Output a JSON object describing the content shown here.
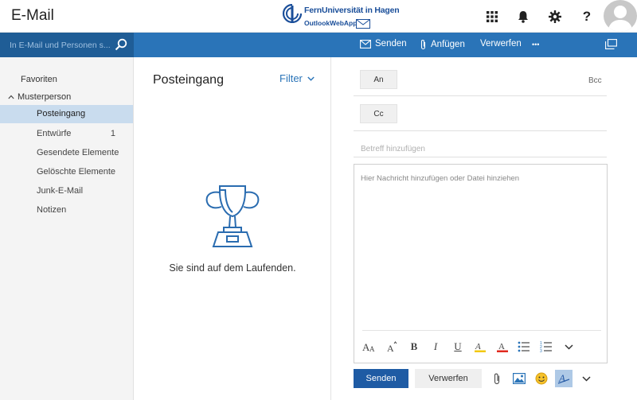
{
  "header": {
    "app_title": "E-Mail",
    "logo_university": "FernUniversität in Hagen",
    "logo_product": "OutlookWebApp",
    "icons": [
      "app-launcher-icon",
      "bell-icon",
      "gear-icon",
      "help-icon",
      "avatar"
    ]
  },
  "commandbar": {
    "search_placeholder": "In E-Mail und Personen s...",
    "send_label": "Senden",
    "attach_label": "Anfügen",
    "discard_label": "Verwerfen",
    "more_label": "•••"
  },
  "folders": {
    "favorites_label": "Favoriten",
    "account_label": "Musterperson",
    "items": [
      {
        "label": "Posteingang",
        "count": ""
      },
      {
        "label": "Entwürfe",
        "count": "1"
      },
      {
        "label": "Gesendete Elemente",
        "count": ""
      },
      {
        "label": "Gelöschte Elemente",
        "count": ""
      },
      {
        "label": "Junk-E-Mail",
        "count": ""
      },
      {
        "label": "Notizen",
        "count": ""
      }
    ]
  },
  "list": {
    "title": "Posteingang",
    "filter_label": "Filter",
    "empty_message": "Sie sind auf dem Laufenden."
  },
  "compose": {
    "to_label": "An",
    "cc_label": "Cc",
    "bcc_label": "Bcc",
    "subject_placeholder": "Betreff hinzufügen",
    "body_placeholder": "Hier Nachricht hinzufügen oder Datei hinziehen",
    "send_label": "Senden",
    "discard_label": "Verwerfen"
  },
  "colors": {
    "accent": "#2a74b8",
    "search_bg": "#1f5d96",
    "send_button": "#1e5ba4",
    "selected_folder": "#c9dcee"
  }
}
